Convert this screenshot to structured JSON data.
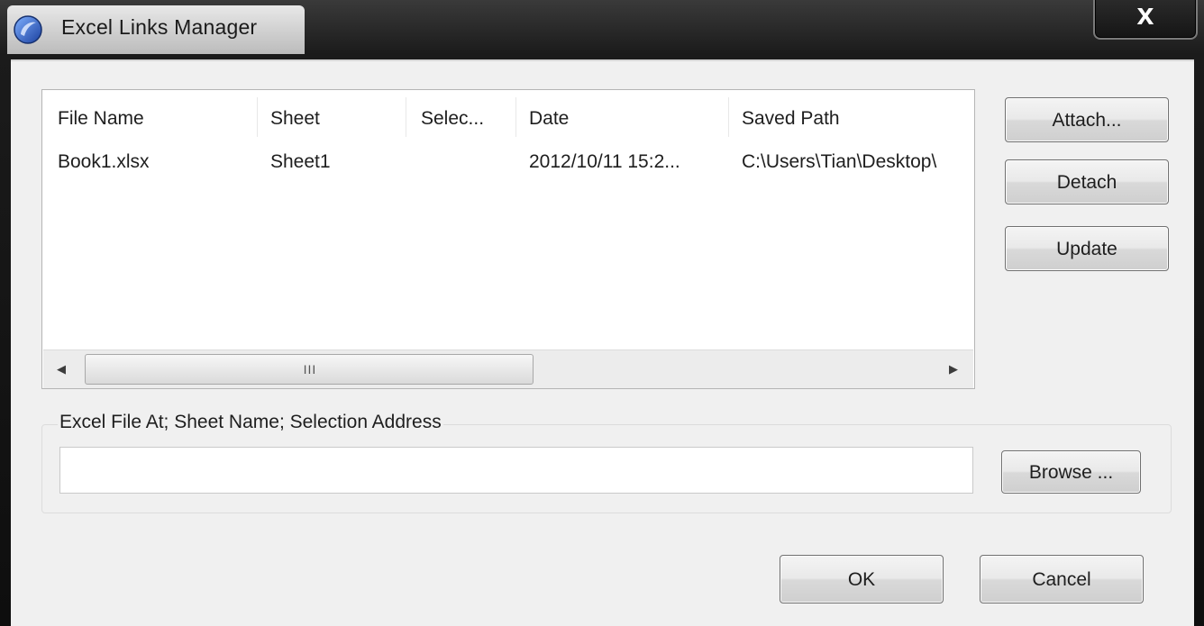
{
  "window": {
    "title": "Excel Links Manager",
    "close_label": "x"
  },
  "links_table": {
    "columns": [
      "File Name",
      "Sheet",
      "Selec...",
      "Date",
      "Saved Path"
    ],
    "rows": [
      [
        "Book1.xlsx",
        "Sheet1",
        "",
        "2012/10/11 15:2...",
        "C:\\Users\\Tian\\Desktop\\"
      ]
    ],
    "scroll_grip": "III"
  },
  "side_buttons": {
    "attach": "Attach...",
    "detach": "Detach",
    "update": "Update"
  },
  "file_group": {
    "label": "Excel File At; Sheet Name; Selection Address",
    "input_value": "",
    "browse": "Browse ..."
  },
  "footer": {
    "ok": "OK",
    "cancel": "Cancel"
  },
  "icons": {
    "app": "app-logo-icon",
    "close": "close-icon",
    "scroll_left": "arrow-left-icon",
    "scroll_right": "arrow-right-icon"
  }
}
